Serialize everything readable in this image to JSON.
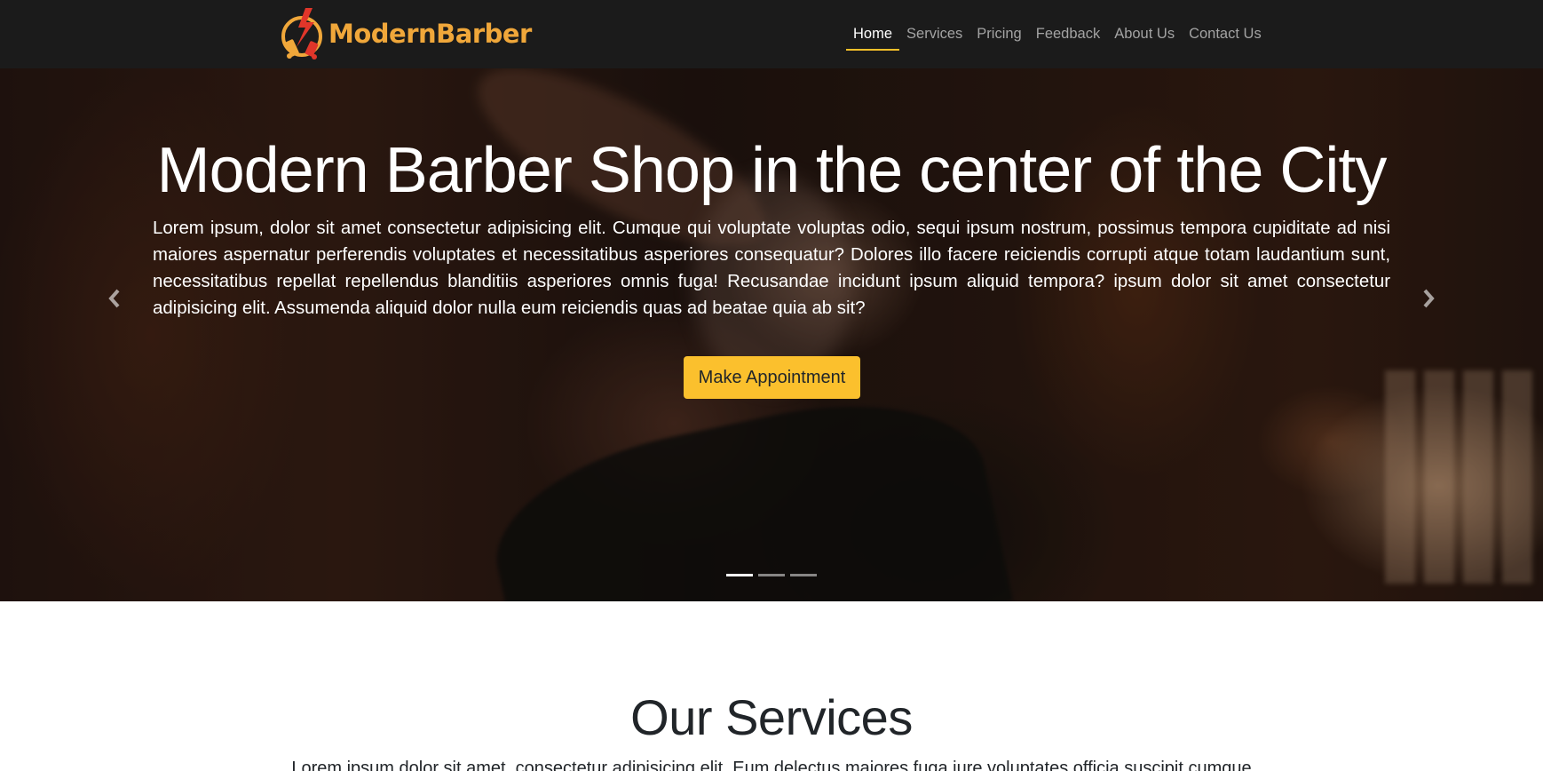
{
  "navbar": {
    "brand": "ModernBarber",
    "items": [
      {
        "label": "Home",
        "active": true
      },
      {
        "label": "Services",
        "active": false
      },
      {
        "label": "Pricing",
        "active": false
      },
      {
        "label": "Feedback",
        "active": false
      },
      {
        "label": "About Us",
        "active": false
      },
      {
        "label": "Contact Us",
        "active": false
      }
    ]
  },
  "hero": {
    "title": "Modern Barber Shop in the center of the City",
    "text": "Lorem ipsum, dolor sit amet consectetur adipisicing elit. Cumque qui voluptate voluptas odio, sequi ipsum nostrum, possimus tempora cupiditate ad nisi maiores aspernatur perferendis voluptates et necessitatibus asperiores consequatur? Dolores illo facere reiciendis corrupti atque totam laudantium sunt, necessitatibus repellat repellendus blanditiis asperiores omnis fuga! Recusandae incidunt ipsum aliquid tempora? ipsum dolor sit amet consectetur adipisicing elit. Assumenda aliquid dolor nulla eum reiciendis quas ad beatae quia ab sit?",
    "button_label": "Make Appointment",
    "prev_icon": "chevron-left-icon",
    "next_icon": "chevron-right-icon",
    "slide_count": 3,
    "active_slide": 1
  },
  "services": {
    "title": "Our Services",
    "text": "Lorem ipsum dolor sit amet, consectetur adipisicing elit. Eum delectus maiores fuga iure voluptates officia suscipit cumque"
  },
  "colors": {
    "navbar_bg": "#1b1b1b",
    "accent": "#fbc02d",
    "brand": "#f0a73a",
    "nav_inactive": "#a3a3a3"
  }
}
